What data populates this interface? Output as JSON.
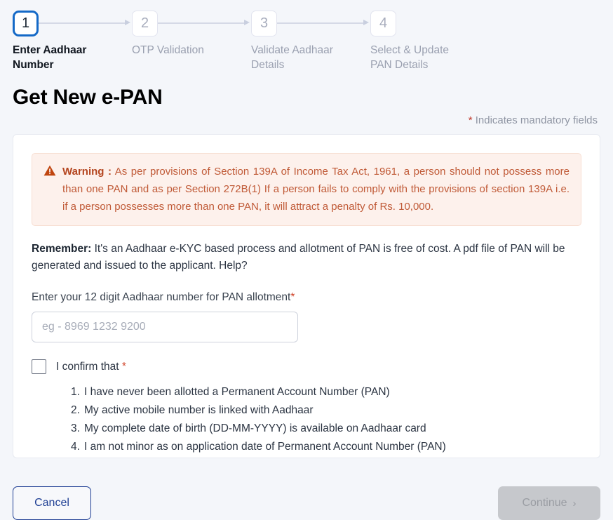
{
  "stepper": {
    "steps": [
      {
        "number": "1",
        "label": "Enter Aadhaar Number",
        "state": "active"
      },
      {
        "number": "2",
        "label": "OTP Validation",
        "state": "upcoming"
      },
      {
        "number": "3",
        "label": "Validate Aadhaar Details",
        "state": "upcoming"
      },
      {
        "number": "4",
        "label": "Select & Update PAN Details",
        "state": "upcoming"
      }
    ]
  },
  "header": {
    "title": "Get New e-PAN",
    "mandatory_star": "*",
    "mandatory_note": " Indicates mandatory fields"
  },
  "warning": {
    "icon": "warning-triangle-icon",
    "label": "Warning :",
    "text": " As per provisions of Section 139A of Income Tax Act, 1961, a person should not possess more than one PAN and as per Section 272B(1) If a person fails to comply with the provisions of section 139A i.e. if a person possesses more than one PAN, it will attract a penalty of Rs. 10,000."
  },
  "remember": {
    "label": "Remember:",
    "text": " It's an Aadhaar e-KYC based process and allotment of PAN is free of cost. A pdf file of PAN will be generated and issued to the applicant. Help?"
  },
  "aadhaar_field": {
    "label": "Enter your 12 digit Aadhaar number for PAN allotment",
    "star": "*",
    "placeholder": "eg - 8969 1232 9200",
    "value": ""
  },
  "confirm": {
    "checked": false,
    "label": "I confirm that ",
    "star": "*",
    "conditions": [
      {
        "num": "1.",
        "text": "I have never been allotted a Permanent Account Number (PAN)"
      },
      {
        "num": "2.",
        "text": "My active mobile number is linked with Aadhaar"
      },
      {
        "num": "3.",
        "text": "My complete date of birth (DD-MM-YYYY) is available on Aadhaar card"
      },
      {
        "num": "4.",
        "text": "I am not minor as on application date of Permanent Account Number (PAN)"
      }
    ]
  },
  "footer": {
    "cancel_label": "Cancel",
    "continue_label": "Continue",
    "continue_chevron": "›",
    "continue_disabled": true
  },
  "colors": {
    "accent_blue": "#1469c7",
    "cancel_blue": "#1f3f94",
    "warning_text": "#c05a37",
    "warning_bg": "#fdf1ec",
    "required_star": "#d0452b",
    "page_bg": "#f4f6fa"
  }
}
